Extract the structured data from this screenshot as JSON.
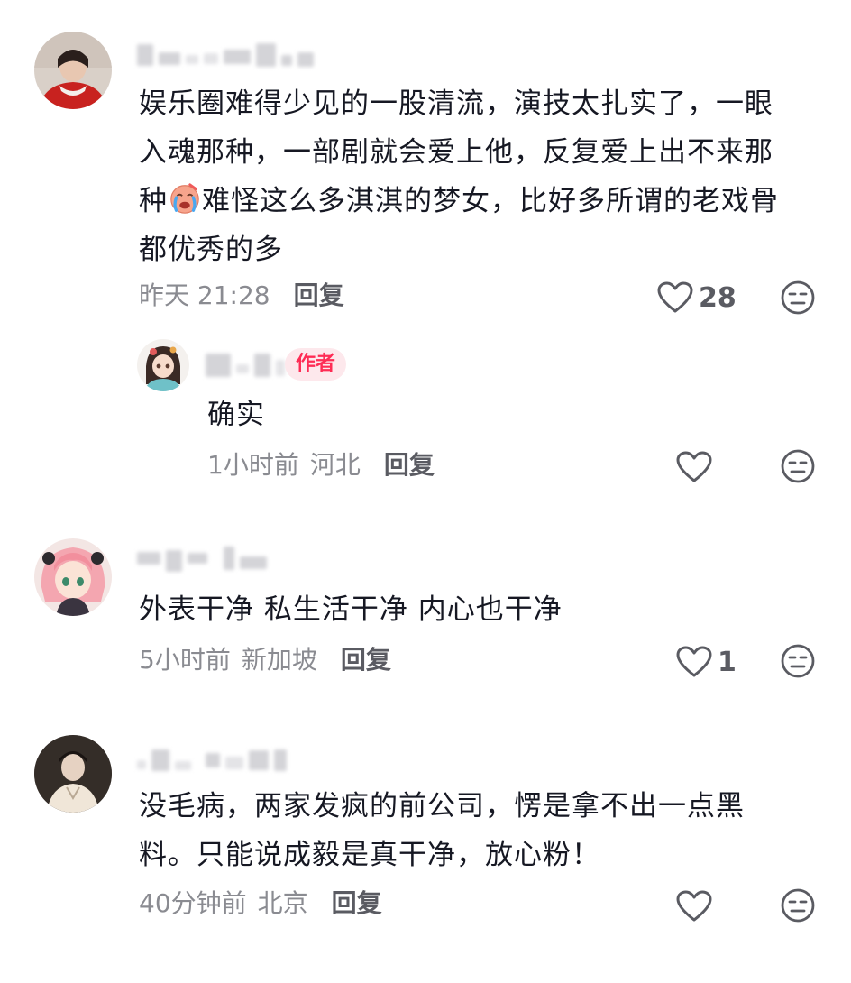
{
  "comments": [
    {
      "text_line1": "娱乐圈难得少见的一股清流，演技太扎实了，一眼",
      "text_line2": "入魂那种，一部剧就会爱上他，反复爱上出不来那",
      "text_line3_pre": "种",
      "text_line3_post": "难怪这么多淇淇的梦女，比好多所谓的老戏骨",
      "text_line4": "都优秀的多",
      "emoji": "crying-face-emoji",
      "time": "昨天 21:28",
      "reply_label": "回复",
      "like_count": "28",
      "reply": {
        "badge": "作者",
        "text": "确实",
        "time": "1小时前",
        "location": "河北",
        "reply_label": "回复"
      }
    },
    {
      "text": "外表干净 私生活干净 内心也干净",
      "time": "5小时前",
      "location": "新加坡",
      "reply_label": "回复",
      "like_count": "1"
    },
    {
      "text_line1": "没毛病，两家发疯的前公司，愣是拿不出一点黑",
      "text_line2": "料。只能说成毅是真干净，放心粉！",
      "time": "40分钟前",
      "location": "北京",
      "reply_label": "回复"
    }
  ],
  "colors": {
    "primary_text": "#161823",
    "secondary_text": "#8a8b91",
    "accent": "#fe2c55",
    "badge_bg": "#fde8ec"
  }
}
